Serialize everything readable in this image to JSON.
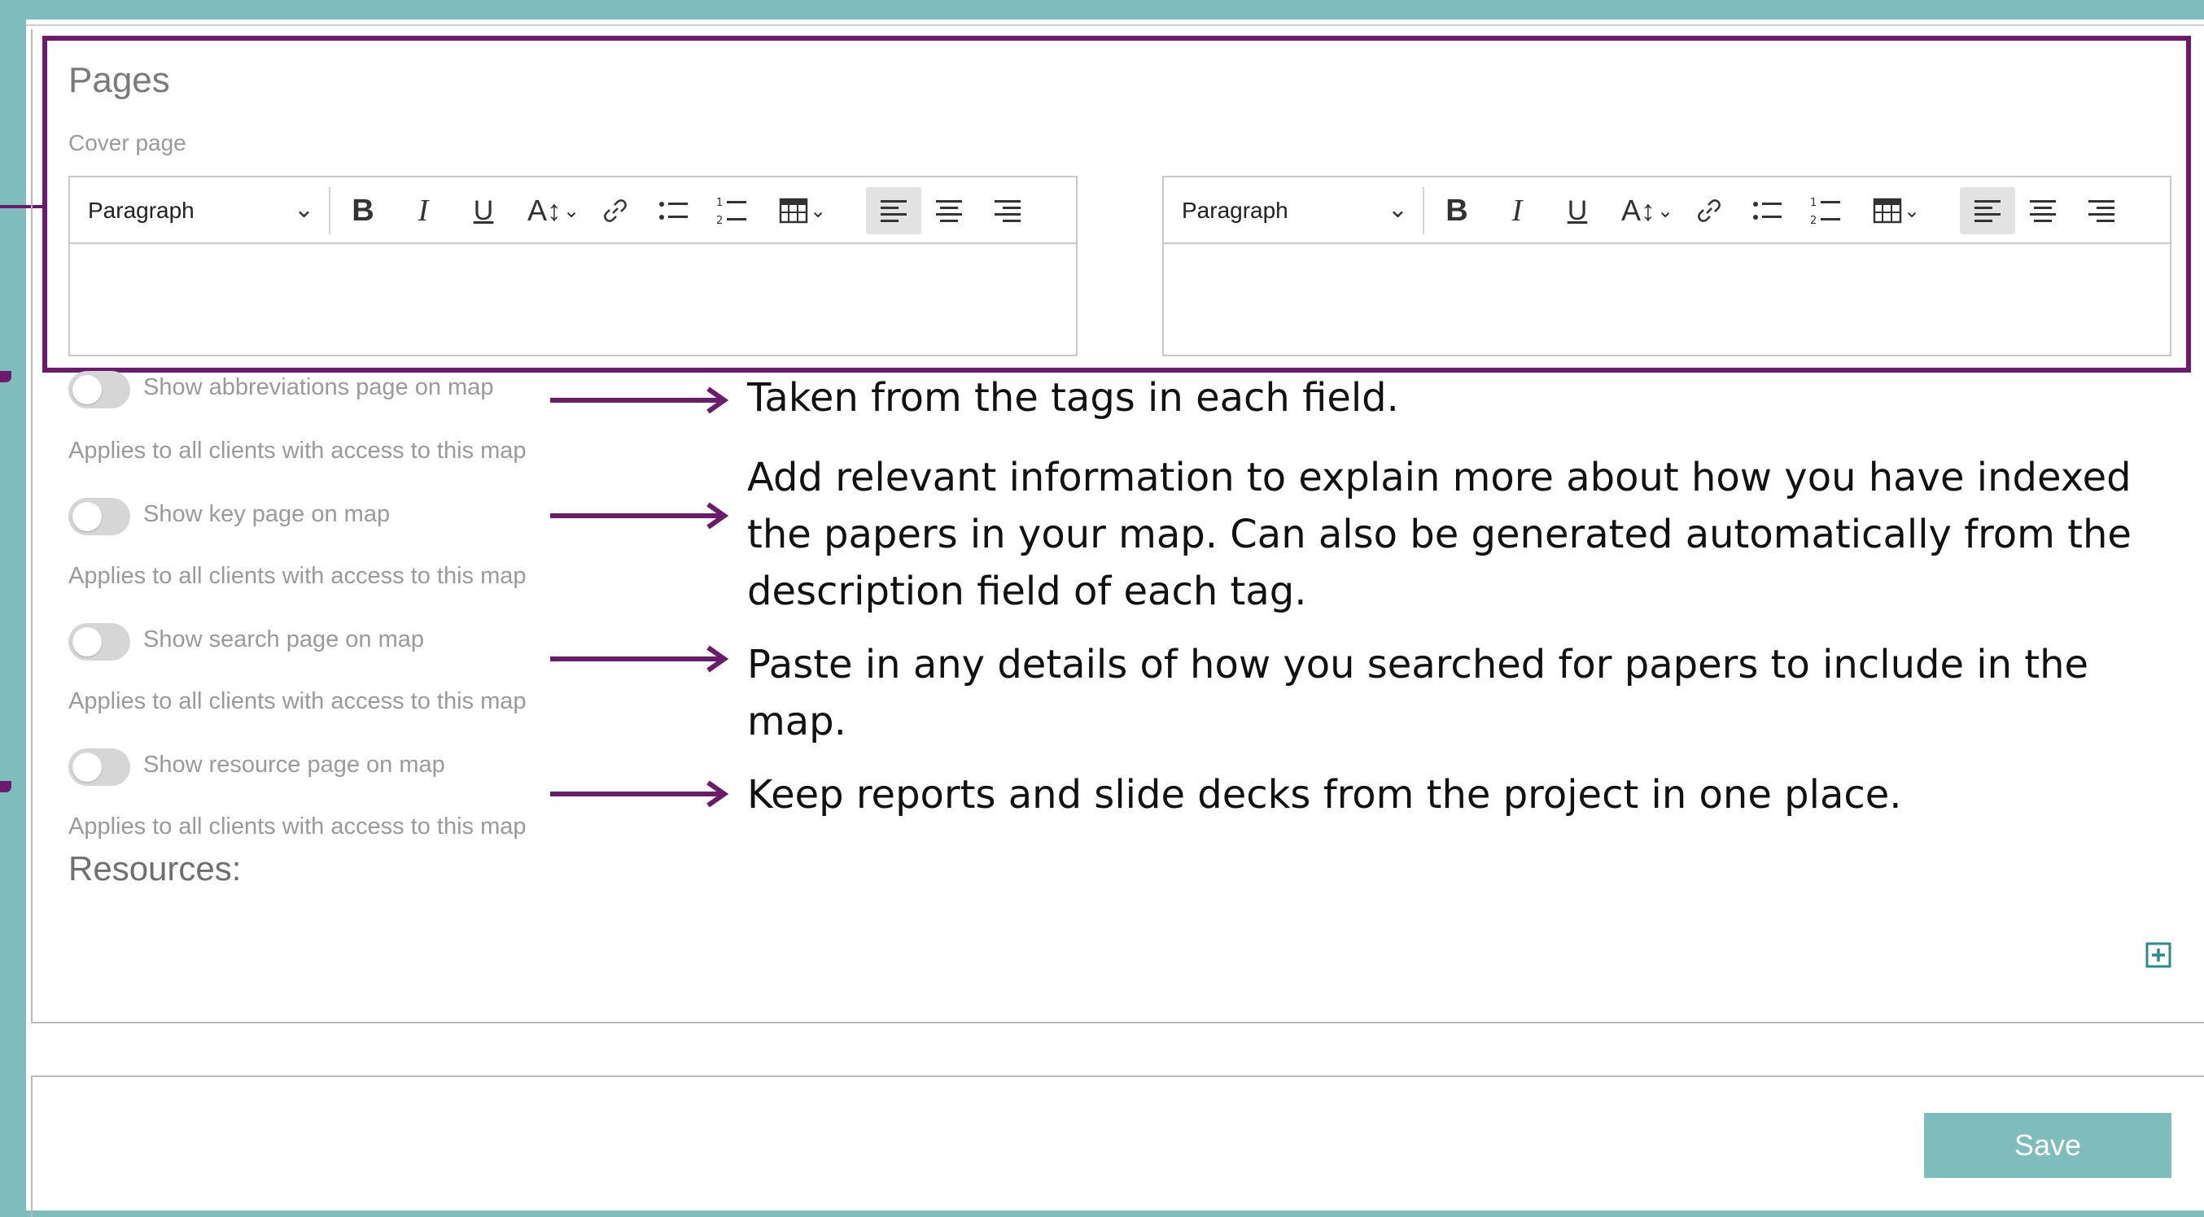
{
  "pages": {
    "title": "Pages",
    "cover_label": "Cover page",
    "editors": [
      {
        "block_style": "Paragraph"
      },
      {
        "block_style": "Paragraph"
      }
    ]
  },
  "toggles": [
    {
      "label": "Show abbreviations page on map",
      "note": "Applies to all clients with access to this map",
      "checked": false
    },
    {
      "label": "Show key page on map",
      "note": "Applies to all clients with access to this map",
      "checked": false
    },
    {
      "label": "Show search page on map",
      "note": "Applies to all clients with access to this map",
      "checked": false
    },
    {
      "label": "Show resource page on map",
      "note": "Applies to all clients with access to this map",
      "checked": false
    }
  ],
  "annotations": [
    {
      "text": "Taken from the tags in each field."
    },
    {
      "text": "Add relevant information to explain more about how you have indexed the papers in your map. Can also be generated automatically from the description field of each tag."
    },
    {
      "text": "Paste in any details of how you searched for papers to include in the map."
    },
    {
      "text": "Keep reports and slide decks from the project in one place."
    }
  ],
  "resources": {
    "label": "Resources:"
  },
  "footer": {
    "save_label": "Save"
  },
  "colors": {
    "teal": "#7fbcbc",
    "annotation_purple": "#6c1a6c",
    "active_toolbar_bg": "#e2e2e2"
  },
  "icons": [
    "bold-icon",
    "italic-icon",
    "underline-icon",
    "text-size-icon",
    "link-icon",
    "bullet-list-icon",
    "numbered-list-icon",
    "table-icon",
    "align-left-icon",
    "align-center-icon",
    "align-right-icon",
    "add-icon"
  ]
}
